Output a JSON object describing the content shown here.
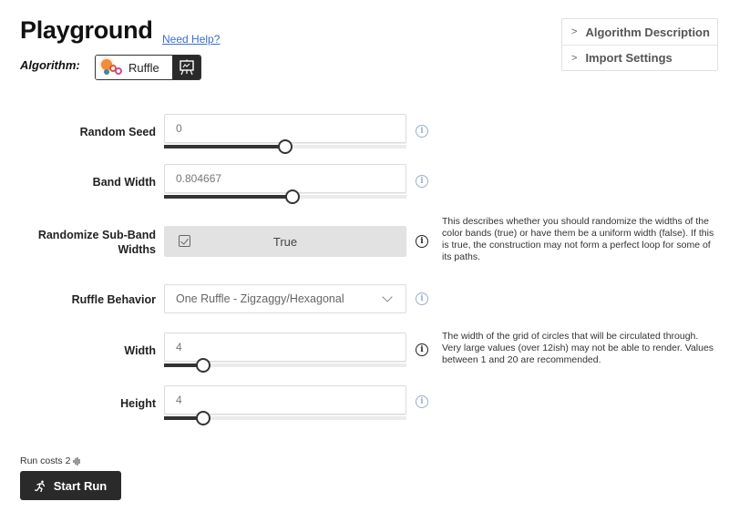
{
  "header": {
    "title": "Playground",
    "help_link": "Need Help?",
    "algorithm_label": "Algorithm:",
    "algorithm_name": "Ruffle",
    "algorithm_icon": "ruffle-logo-icon",
    "present_icon": "presentation-icon"
  },
  "side_panel": {
    "items": [
      {
        "label": "Algorithm Description",
        "icon": "chevron-right-icon"
      },
      {
        "label": "Import Settings",
        "icon": "chevron-right-icon"
      }
    ]
  },
  "params": {
    "random_seed": {
      "label": "Random Seed",
      "value": "0",
      "slider_fraction": 0.5
    },
    "band_width": {
      "label": "Band Width",
      "value": "0.804667",
      "slider_fraction": 0.53
    },
    "randomize_sub_band_widths": {
      "label": "Randomize Sub-Band Widths",
      "value": "True",
      "checked": true,
      "description": "This describes whether you should randomize the widths of the color bands (true) or have them be a uniform width (false). If this is true, the construction may not form a perfect loop for some of its paths."
    },
    "ruffle_behavior": {
      "label": "Ruffle Behavior",
      "value": "One Ruffle - Zigzaggy/Hexagonal"
    },
    "width": {
      "label": "Width",
      "value": "4",
      "slider_fraction": 0.16,
      "description": "The width of the grid of circles that will be circulated through. Very large values (over 12ish) may not be able to render. Values between 1 and 20 are recommended."
    },
    "height": {
      "label": "Height",
      "value": "4",
      "slider_fraction": 0.16
    }
  },
  "run": {
    "cost_text": "Run costs 2",
    "cost_icon": "credits-icon",
    "button_label": "Start Run",
    "button_icon": "running-person-icon"
  }
}
